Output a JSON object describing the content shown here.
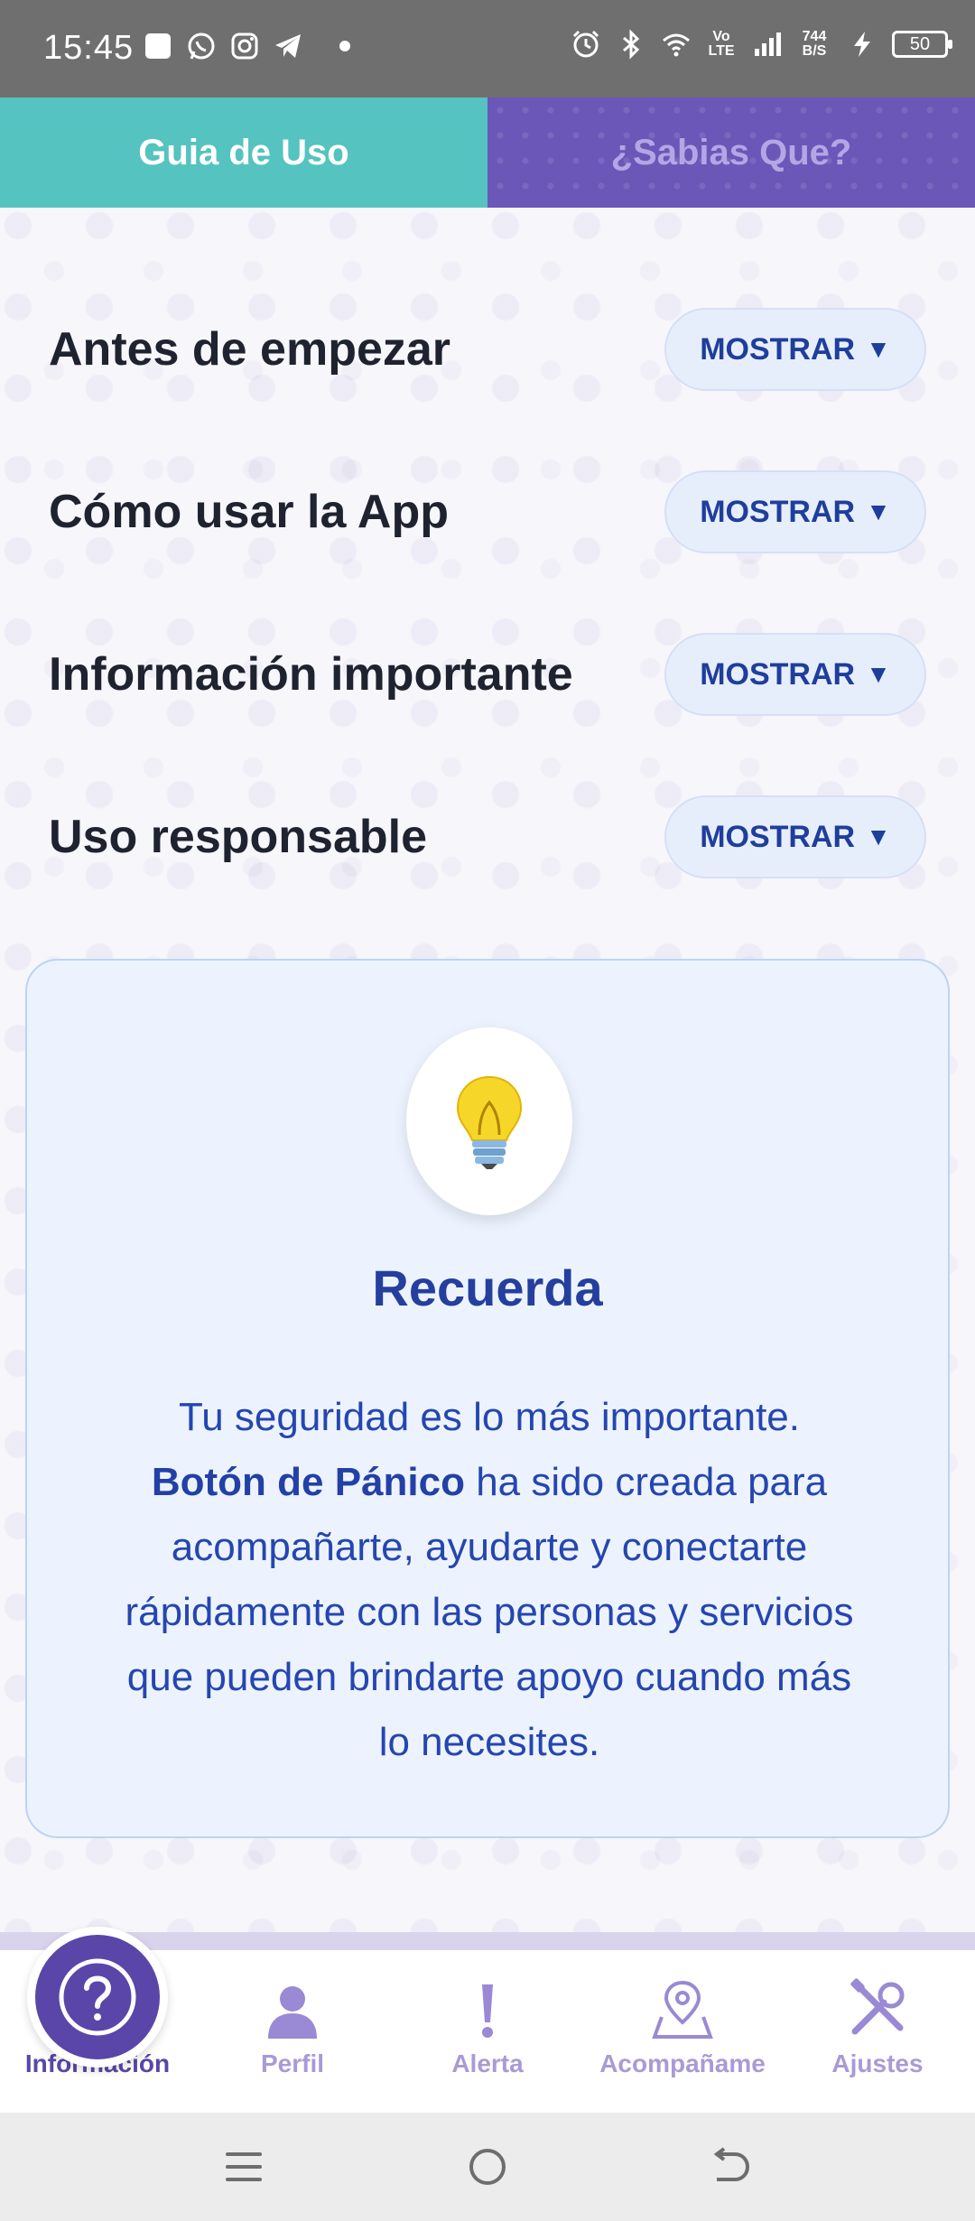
{
  "status_bar": {
    "time": "15:45",
    "volte": "Vo LTE",
    "net_speed": "744 B/S",
    "battery": "50"
  },
  "tabs": [
    {
      "label": "Guia de Uso",
      "active": true
    },
    {
      "label": "¿Sabias Que?",
      "active": false
    }
  ],
  "sections": [
    {
      "title": "Antes de empezar",
      "button": "MOSTRAR"
    },
    {
      "title": "Cómo usar la App",
      "button": "MOSTRAR"
    },
    {
      "title": "Información importante",
      "button": "MOSTRAR"
    },
    {
      "title": "Uso responsable",
      "button": "MOSTRAR"
    }
  ],
  "remember_card": {
    "icon": "lightbulb-icon",
    "title": "Recuerda",
    "line1": "Tu seguridad es lo más importante.",
    "app_name": "Botón de Pánico",
    "rest": " ha sido creada para acompañarte, ayudarte y conectarte rápidamente con las personas y servicios que pueden brindarte apoyo cuando más lo necesites."
  },
  "bottom_nav": [
    {
      "label": "Información",
      "icon": "question-icon",
      "active": true
    },
    {
      "label": "Perfil",
      "icon": "person-icon",
      "active": false
    },
    {
      "label": "Alerta",
      "icon": "exclamation-icon",
      "active": false
    },
    {
      "label": "Acompañame",
      "icon": "map-pin-icon",
      "active": false
    },
    {
      "label": "Ajustes",
      "icon": "tools-icon",
      "active": false
    }
  ],
  "colors": {
    "tab_active": "#55c3bf",
    "tab_inactive": "#6a57b8",
    "primary_text": "#243f9e",
    "nav_active": "#5a46a8",
    "nav_inactive": "#a99ad6"
  }
}
